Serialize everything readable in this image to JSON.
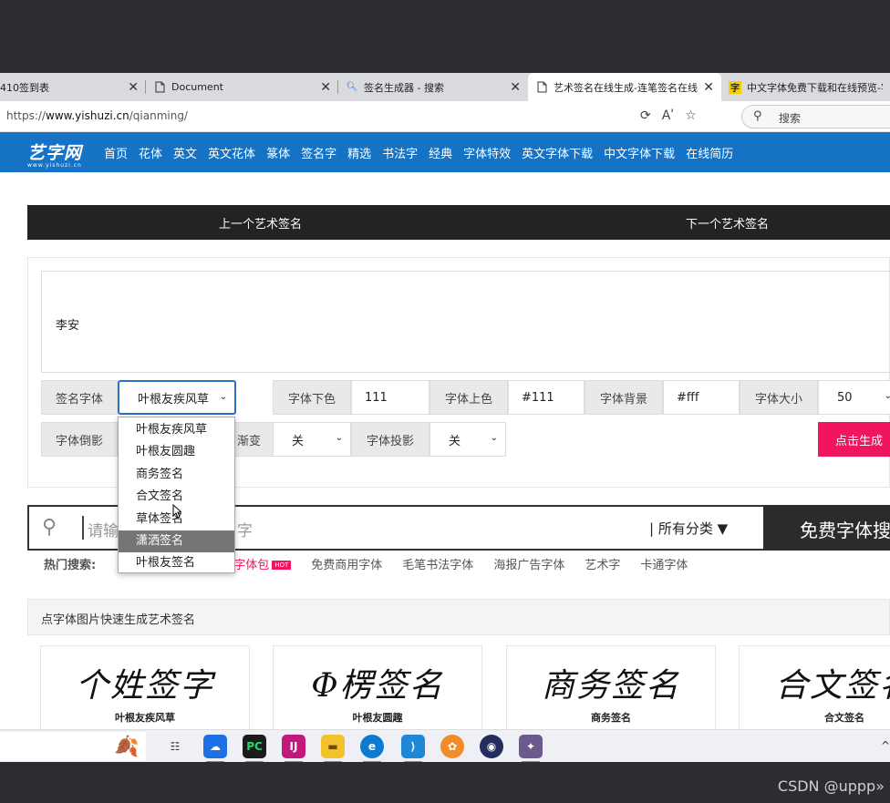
{
  "tabs": [
    {
      "label": "410签到表",
      "icon": "none"
    },
    {
      "label": "Document",
      "icon": "page-icon"
    },
    {
      "label": "签名生成器 - 搜索",
      "icon": "search-icon"
    },
    {
      "label": "艺术签名在线生成-连笔签名在线生",
      "icon": "page-icon",
      "active": true
    },
    {
      "label": "中文字体免费下载和在线预览-字",
      "icon": "zi-icon"
    }
  ],
  "address": {
    "prefix": "https://",
    "domain": "www.yishuzi.cn",
    "path": "/qianming/"
  },
  "browser_search": {
    "placeholder": "搜索"
  },
  "logo": {
    "text": "艺字网",
    "sub": "www.yishuzi.cn"
  },
  "nav": [
    "首页",
    "花体",
    "英文",
    "英文花体",
    "篆体",
    "签名字",
    "精选",
    "书法字",
    "经典",
    "字体特效",
    "英文字体下载",
    "中文字体下载",
    "在线简历"
  ],
  "prevnext": {
    "prev": "上一个艺术签名",
    "next": "下一个艺术签名"
  },
  "form": {
    "name_value": "李安",
    "font_label": "签名字体",
    "font_value": "叶根友疾风草",
    "lower_color_label": "字体下色",
    "lower_color_value": "111",
    "upper_color_label": "字体上色",
    "upper_color_value": "#111",
    "bg_label": "字体背景",
    "bg_value": "#fff",
    "size_label": "字体大小",
    "size_value": "50",
    "reflection_label": "字体倒影",
    "gradient_label": "渐变",
    "gradient_value": "关",
    "shadow_label": "字体投影",
    "shadow_value": "关",
    "generate_label": "点击生成"
  },
  "dropdown": {
    "options": [
      "叶根友疾风草",
      "叶根友圆趣",
      "商务签名",
      "合文签名",
      "草体签名",
      "潇洒签名",
      "叶根友签名"
    ],
    "highlighted": 5
  },
  "searchbar": {
    "placeholder": "请输",
    "placeholder_tail": "字",
    "category": "| 所有分类 ▼",
    "button": "免费字体搜"
  },
  "hot": {
    "label": "热门搜索:",
    "items": [
      "费字体包",
      "免费商用字体",
      "毛笔书法字体",
      "海报广告字体",
      "艺术字",
      "卡通字体"
    ],
    "badge": "HOT"
  },
  "section_title": "点字体图片快速生成艺术签名",
  "cards": [
    {
      "sig": "个姓签字",
      "name": "叶根友疾风草"
    },
    {
      "sig": "Φ楞签名",
      "name": "叶根友圆趣"
    },
    {
      "sig": "商务签名",
      "name": "商务签名"
    },
    {
      "sig": "合文签名",
      "name": "合文签名"
    }
  ],
  "watermark": "CSDN @uppp»",
  "colors": {
    "nav_bg": "#1572c5",
    "accent": "#f0155d",
    "dark": "#232323"
  }
}
